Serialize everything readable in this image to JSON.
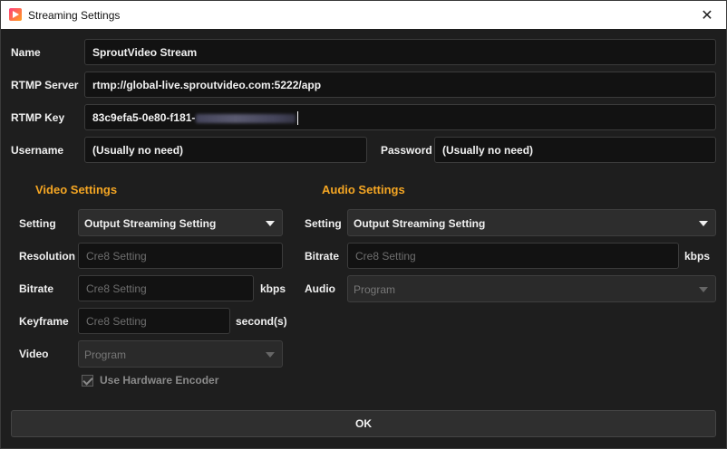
{
  "window": {
    "title": "Streaming Settings",
    "close_glyph": "✕"
  },
  "fields": {
    "name": {
      "label": "Name",
      "value": "SproutVideo Stream"
    },
    "rtmp_server": {
      "label": "RTMP Server",
      "value": "rtmp://global-live.sproutvideo.com:5222/app"
    },
    "rtmp_key": {
      "label": "RTMP Key",
      "value": "83c9efa5-0e80-f181-"
    },
    "username": {
      "label": "Username",
      "value": "(Usually no need)"
    },
    "password": {
      "label": "Password",
      "value": "(Usually no need)"
    }
  },
  "video": {
    "heading": "Video Settings",
    "setting": {
      "label": "Setting",
      "value": "Output Streaming Setting"
    },
    "resolution": {
      "label": "Resolution",
      "placeholder": "Cre8 Setting"
    },
    "bitrate": {
      "label": "Bitrate",
      "placeholder": "Cre8 Setting",
      "unit": "kbps"
    },
    "keyframe": {
      "label": "Keyframe",
      "placeholder": "Cre8 Setting",
      "unit": "second(s)"
    },
    "video_source": {
      "label": "Video",
      "value": "Program"
    },
    "hw_encoder": {
      "label": "Use Hardware Encoder",
      "checked": true
    }
  },
  "audio": {
    "heading": "Audio Settings",
    "setting": {
      "label": "Setting",
      "value": "Output Streaming Setting"
    },
    "bitrate": {
      "label": "Bitrate",
      "placeholder": "Cre8 Setting",
      "unit": "kbps"
    },
    "audio_source": {
      "label": "Audio",
      "value": "Program"
    }
  },
  "ok_button": {
    "label": "OK"
  },
  "colors": {
    "accent": "#f5a623",
    "background": "#1e1e1e",
    "titlebar": "#ffffff"
  }
}
